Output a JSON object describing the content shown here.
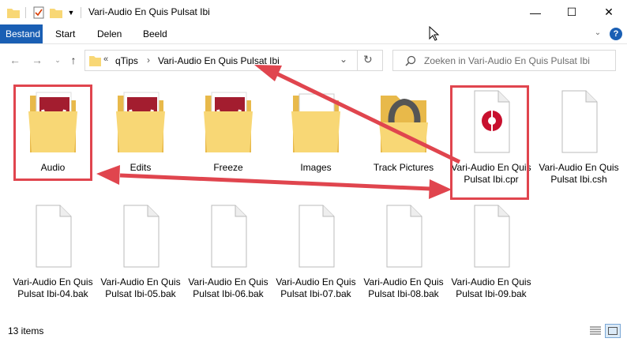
{
  "window": {
    "title": "Vari-Audio En Quis Pulsat Ibi"
  },
  "window_controls": {
    "minimize": "—",
    "maximize": "☐",
    "close": "✕"
  },
  "ribbon": {
    "tabs": [
      "Bestand",
      "Start",
      "Delen",
      "Beeld"
    ]
  },
  "address": {
    "chevron": "«",
    "parts": [
      "qTips",
      "Vari-Audio En Quis Pulsat Ibi"
    ],
    "separator": "›"
  },
  "search": {
    "placeholder": "Zoeken in Vari-Audio En Quis Pulsat Ibi"
  },
  "files": [
    {
      "name": "Audio",
      "type": "folder-brand",
      "highlighted": true
    },
    {
      "name": "Edits",
      "type": "folder-brand"
    },
    {
      "name": "Freeze",
      "type": "folder-brand"
    },
    {
      "name": "Images",
      "type": "folder"
    },
    {
      "name": "Track Pictures",
      "type": "folder-horseshoe"
    },
    {
      "name": "Vari-Audio En Quis Pulsat Ibi.cpr",
      "type": "cpr",
      "highlighted": true
    },
    {
      "name": "Vari-Audio En Quis Pulsat Ibi.csh",
      "type": "doc"
    },
    {
      "name": "Vari-Audio En Quis Pulsat Ibi-04.bak",
      "type": "doc"
    },
    {
      "name": "Vari-Audio En Quis Pulsat Ibi-05.bak",
      "type": "doc"
    },
    {
      "name": "Vari-Audio En Quis Pulsat Ibi-06.bak",
      "type": "doc"
    },
    {
      "name": "Vari-Audio En Quis Pulsat Ibi-07.bak",
      "type": "doc"
    },
    {
      "name": "Vari-Audio En Quis Pulsat Ibi-08.bak",
      "type": "doc"
    },
    {
      "name": "Vari-Audio En Quis Pulsat Ibi-09.bak",
      "type": "doc"
    }
  ],
  "status": {
    "count": "13 items"
  },
  "colors": {
    "accent": "#1a5fb4",
    "highlight": "#e0454e",
    "folder": "#f8d775",
    "brand": "#a31d2f"
  }
}
